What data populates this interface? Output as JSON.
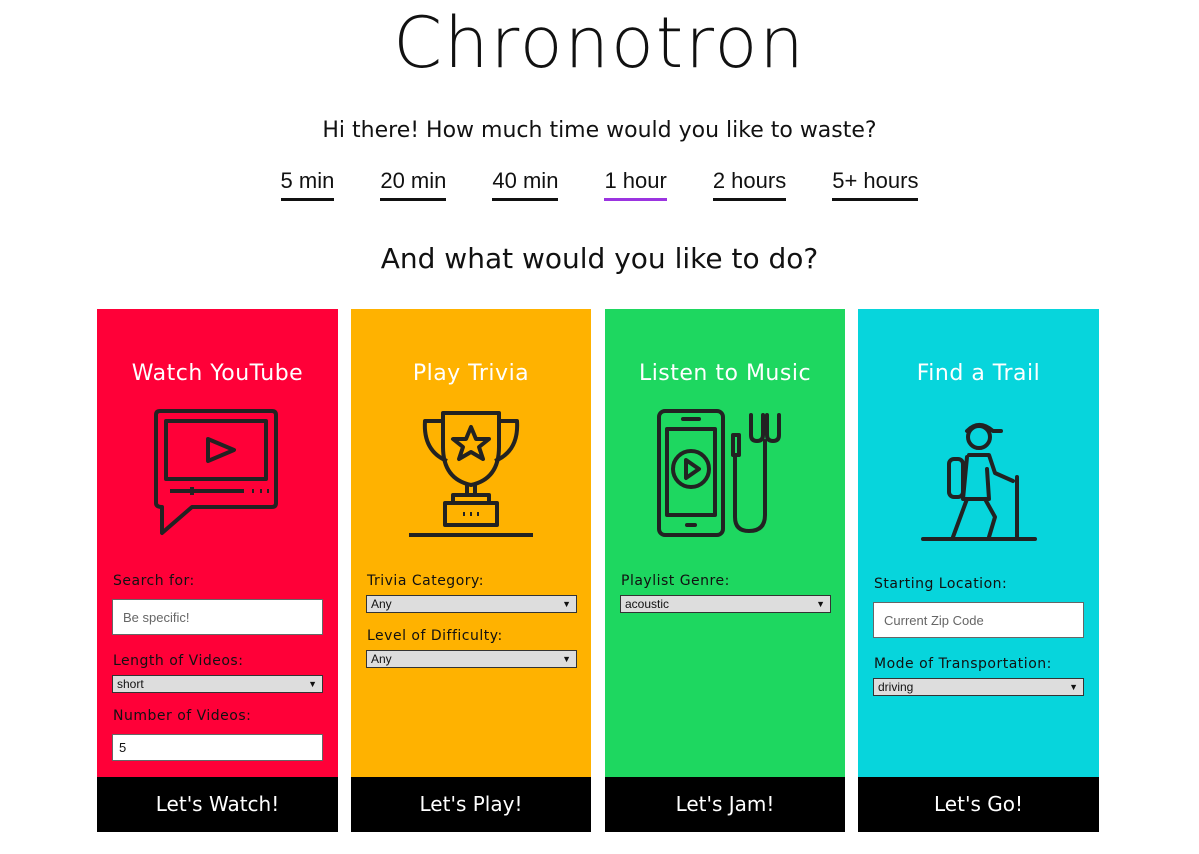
{
  "app": {
    "title": "Chronotron"
  },
  "prompts": {
    "time_question": "Hi there! How much time would you like to waste?",
    "activity_question": "And what would you like to do?"
  },
  "time_options": [
    {
      "label": "5 min",
      "selected": false
    },
    {
      "label": "20 min",
      "selected": false
    },
    {
      "label": "40 min",
      "selected": false
    },
    {
      "label": "1 hour",
      "selected": true
    },
    {
      "label": "2 hours",
      "selected": false
    },
    {
      "label": "5+ hours",
      "selected": false
    }
  ],
  "colors": {
    "youtube": "#ff0038",
    "trivia": "#ffb200",
    "music": "#1ed760",
    "trail": "#07d5dc",
    "selected_underline": "#9b34e0"
  },
  "cards": {
    "youtube": {
      "title": "Watch YouTube",
      "icon": "video-chat-icon",
      "search_label": "Search for:",
      "search_placeholder": "Be specific!",
      "search_value": "",
      "length_label": "Length of Videos:",
      "length_value": "short",
      "number_label": "Number of Videos:",
      "number_value": "5",
      "button": "Let's Watch!"
    },
    "trivia": {
      "title": "Play Trivia",
      "icon": "trophy-icon",
      "category_label": "Trivia Category:",
      "category_value": "Any",
      "difficulty_label": "Level of Difficulty:",
      "difficulty_value": "Any",
      "button": "Let's Play!"
    },
    "music": {
      "title": "Listen to Music",
      "icon": "phone-earbuds-icon",
      "genre_label": "Playlist Genre:",
      "genre_value": "acoustic",
      "button": "Let's Jam!"
    },
    "trail": {
      "title": "Find a Trail",
      "icon": "hiker-icon",
      "location_label": "Starting Location:",
      "location_placeholder": "Current Zip Code",
      "location_value": "",
      "transport_label": "Mode of Transportation:",
      "transport_value": "driving",
      "button": "Let's Go!"
    }
  }
}
